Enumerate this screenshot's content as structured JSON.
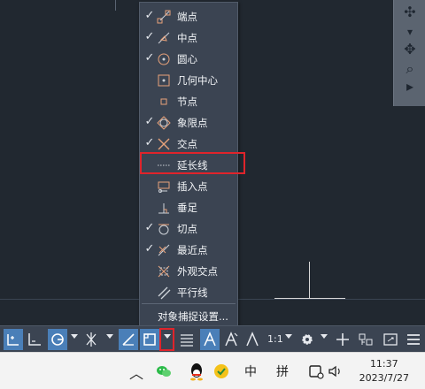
{
  "snap_menu": {
    "items": [
      {
        "label": "端点",
        "checked": true,
        "icon": "endpoint-icon"
      },
      {
        "label": "中点",
        "checked": true,
        "icon": "midpoint-icon"
      },
      {
        "label": "圆心",
        "checked": true,
        "icon": "center-icon"
      },
      {
        "label": "几何中心",
        "checked": false,
        "icon": "geometric-center-icon"
      },
      {
        "label": "节点",
        "checked": false,
        "icon": "node-icon"
      },
      {
        "label": "象限点",
        "checked": true,
        "icon": "quadrant-icon"
      },
      {
        "label": "交点",
        "checked": true,
        "icon": "intersection-icon"
      },
      {
        "label": "延长线",
        "checked": false,
        "icon": "extension-icon",
        "highlighted": true
      },
      {
        "label": "插入点",
        "checked": false,
        "icon": "insertion-icon"
      },
      {
        "label": "垂足",
        "checked": false,
        "icon": "perpendicular-icon"
      },
      {
        "label": "切点",
        "checked": true,
        "icon": "tangent-icon"
      },
      {
        "label": "最近点",
        "checked": true,
        "icon": "nearest-icon"
      },
      {
        "label": "外观交点",
        "checked": false,
        "icon": "apparent-intersection-icon"
      },
      {
        "label": "平行线",
        "checked": false,
        "icon": "parallel-icon"
      }
    ],
    "settings_label": "对象捕捉设置...",
    "check_glyph": "✓"
  },
  "statusbar": {
    "scale_label": "1:1"
  },
  "taskbar": {
    "ime_chinese": "中",
    "ime_pinyin": "拼",
    "time": "11:37",
    "date": "2023/7/27",
    "chevron_glyph": "︿"
  },
  "colors": {
    "highlight": "#e0242b",
    "snap_icon": "#e8a27a",
    "active_button": "#4a7fb8"
  }
}
